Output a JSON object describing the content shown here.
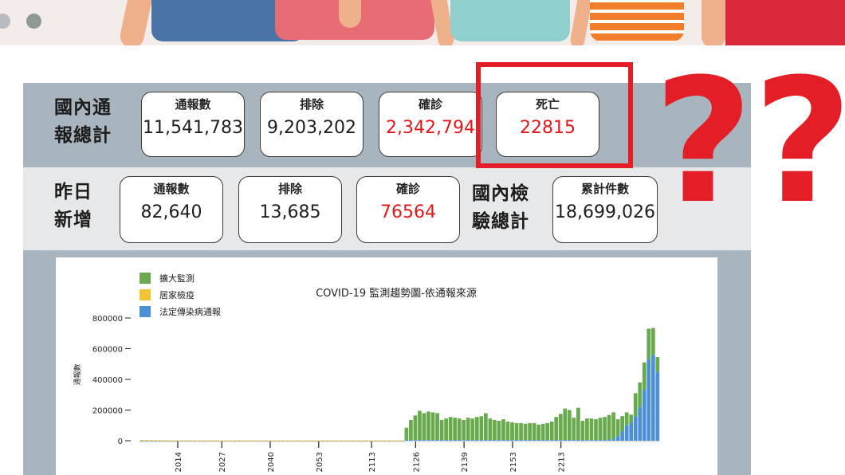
{
  "colors": {
    "panel": "#a9b5be",
    "red": "#e5161b",
    "green": "#6aaa4f",
    "yellow": "#f3c333",
    "blue": "#4b8fd6"
  },
  "domestic_total": {
    "label_line1": "國內通",
    "label_line2": "報總計",
    "reported": {
      "title": "通報數",
      "value": "11,541,783"
    },
    "excluded": {
      "title": "排除",
      "value": "9,203,202"
    },
    "confirmed": {
      "title": "確診",
      "value": "2,342,794"
    },
    "deaths": {
      "title": "死亡",
      "value": "22815"
    }
  },
  "yesterday": {
    "label_line1": "昨日",
    "label_line2": "新增",
    "reported": {
      "title": "通報數",
      "value": "82,640"
    },
    "excluded": {
      "title": "排除",
      "value": "13,685"
    },
    "confirmed": {
      "title": "確診",
      "value": "76564"
    }
  },
  "testing": {
    "label_line1": "國內檢",
    "label_line2": "驗總計",
    "cumulative": {
      "title": "累計件數",
      "value": "18,699,026"
    }
  },
  "annotation": {
    "question_marks": "??"
  },
  "chart_data": {
    "type": "bar",
    "title": "COVID-19 監測趨勢圖-依通報來源",
    "ylabel": "通報數",
    "ylim": [
      0,
      800000
    ],
    "yticks": [
      "800000",
      "600000",
      "400000",
      "200000",
      "0"
    ],
    "xticks": [
      "2014",
      "2027",
      "2040",
      "2053",
      "2113",
      "2126",
      "2139",
      "2153",
      "2213"
    ],
    "series": [
      {
        "name": "擴大監測",
        "color": "#6aaa4f",
        "values": [
          0,
          0,
          0,
          0,
          0,
          0,
          0,
          0,
          0,
          0,
          0,
          0,
          0,
          0,
          0,
          0,
          0,
          0,
          0,
          0,
          0,
          0,
          0,
          0,
          0,
          0,
          0,
          0,
          0,
          0,
          0,
          0,
          0,
          0,
          0,
          0,
          0,
          0,
          0,
          0,
          0,
          0,
          0,
          0,
          0,
          0,
          0,
          0,
          0,
          0,
          0,
          0,
          0,
          0,
          0,
          0,
          0,
          0,
          0,
          0,
          80000,
          130000,
          160000,
          190000,
          175000,
          185000,
          180000,
          175000,
          130000,
          140000,
          150000,
          145000,
          140000,
          130000,
          145000,
          140000,
          150000,
          155000,
          175000,
          140000,
          130000,
          125000,
          135000,
          120000,
          115000,
          110000,
          110000,
          105000,
          110000,
          110000,
          100000,
          105000,
          110000,
          120000,
          150000,
          170000,
          205000,
          195000,
          145000,
          210000,
          125000,
          140000,
          140000,
          135000,
          145000,
          150000,
          160000,
          175000,
          110000,
          100000,
          85000,
          50000,
          150000,
          160000,
          180000,
          200000,
          175000,
          95000
        ]
      },
      {
        "name": "居家檢疫",
        "color": "#f3c333",
        "values": [
          3000,
          2500,
          2000,
          2000,
          1500,
          1500,
          1000,
          1000,
          1000,
          800,
          800,
          800,
          600,
          600,
          600,
          500,
          500,
          500,
          500,
          500,
          500,
          500,
          500,
          500,
          500,
          500,
          500,
          500,
          500,
          500,
          500,
          500,
          500,
          500,
          500,
          500,
          500,
          500,
          500,
          500,
          500,
          500,
          500,
          500,
          500,
          500,
          500,
          500,
          500,
          500,
          500,
          500,
          500,
          500,
          500,
          500,
          500,
          500,
          500,
          500,
          0,
          0,
          0,
          0,
          0,
          0,
          0,
          0,
          0,
          0,
          0,
          0,
          0,
          0,
          0,
          0,
          0,
          0,
          0,
          0,
          0,
          0,
          0,
          0,
          0,
          0,
          0,
          0,
          0,
          0,
          0,
          0,
          0,
          0,
          0,
          0,
          0,
          0,
          0,
          0,
          0,
          0,
          0,
          0,
          0,
          0,
          0,
          0,
          0,
          0,
          0,
          0,
          0,
          0,
          0,
          0,
          0,
          0
        ]
      },
      {
        "name": "法定傳染病通報",
        "color": "#4b8fd6",
        "values": [
          2000,
          2000,
          2000,
          2000,
          2000,
          2000,
          2000,
          2000,
          2000,
          2000,
          2000,
          2000,
          2000,
          2000,
          2000,
          2000,
          2000,
          2000,
          2000,
          2000,
          2000,
          2000,
          2000,
          2000,
          2000,
          2000,
          2000,
          2000,
          2000,
          2000,
          2000,
          2000,
          2000,
          2000,
          2000,
          2000,
          2000,
          2000,
          2000,
          2000,
          2000,
          2000,
          2000,
          2000,
          2000,
          2000,
          2000,
          2000,
          2000,
          2000,
          2000,
          2000,
          2000,
          2000,
          2000,
          2000,
          2000,
          2000,
          2000,
          2000,
          5000,
          5000,
          5000,
          5000,
          5000,
          5000,
          5000,
          5000,
          5000,
          5000,
          5000,
          5000,
          5000,
          5000,
          5000,
          5000,
          5000,
          5000,
          5000,
          5000,
          5000,
          5000,
          5000,
          5000,
          5000,
          5000,
          5000,
          5000,
          5000,
          5000,
          5000,
          5000,
          5000,
          5000,
          5000,
          5000,
          5000,
          5000,
          5000,
          5000,
          5000,
          5000,
          5000,
          5000,
          5000,
          5000,
          8000,
          10000,
          30000,
          60000,
          100000,
          120000,
          160000,
          220000,
          330000,
          530000,
          560000,
          450000
        ]
      }
    ]
  }
}
